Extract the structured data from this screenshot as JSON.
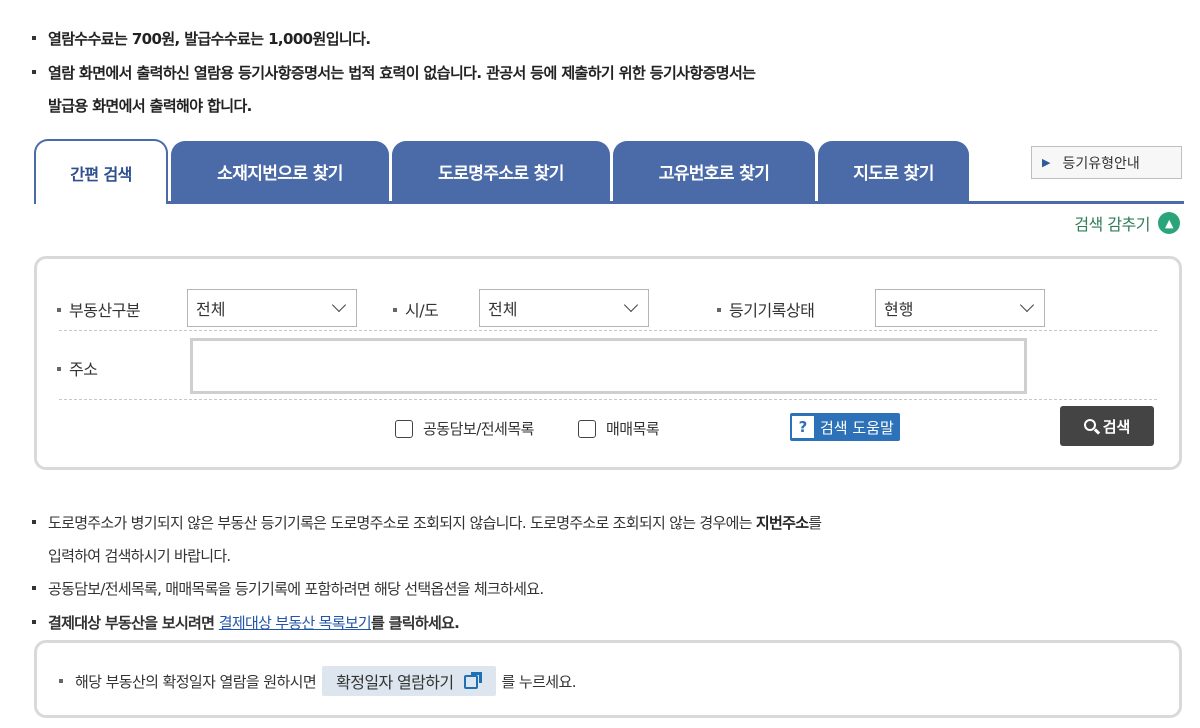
{
  "notices": {
    "fee": "열람수수료는 700원, 발급수수료는 1,000원입니다.",
    "legal_1": "열람 화면에서 출력하신 열람용 등기사항증명서는 법적 효력이 없습니다. 관공서 등에 제출하기 위한 등기사항증명서는",
    "legal_2": "발급용 화면에서 출력해야 합니다."
  },
  "tabs": [
    {
      "label": "간편 검색",
      "active": true
    },
    {
      "label": "소재지번으로 찾기"
    },
    {
      "label": "도로명주소로 찾기"
    },
    {
      "label": "고유번호로 찾기"
    },
    {
      "label": "지도로 찾기"
    }
  ],
  "guide_button": "등기유형안내",
  "hide_search": "검색 감추기",
  "search": {
    "property_type_label": "부동산구분",
    "property_type_value": "전체",
    "city_label": "시/도",
    "city_value": "전체",
    "status_label": "등기기록상태",
    "status_value": "현행",
    "address_label": "주소",
    "address_value": "",
    "checkbox_joint": "공동담보/전세목록",
    "checkbox_sale": "매매목록",
    "help_label": "검색 도움말",
    "search_button": "검색"
  },
  "notes": {
    "road_1a": "도로명주소가 병기되지 않은 부동산 등기기록은 도로명주소로 조회되지 않습니다. 도로명주소로 조회되지 않는 경우에는 ",
    "road_1b": "지번주소",
    "road_1c": "를",
    "road_2": "입력하여 검색하시기 바랍니다.",
    "options": "공동담보/전세목록, 매매목록을 등기기록에 포함하려면 해당 선택옵션을 체크하세요.",
    "payment_a": "결제대상 부동산을 보시려면 ",
    "payment_link": "결제대상 부동산 목록보기",
    "payment_c": "를 클릭하세요."
  },
  "confirm": {
    "prefix": "해당 부동산의 확정일자 열람을 원하시면",
    "button": "확정일자 열람하기",
    "suffix": "를 누르세요."
  },
  "colors": {
    "tab": "#4a6aa8",
    "accent_green": "#2aa57a",
    "help_blue": "#2d72b8"
  }
}
